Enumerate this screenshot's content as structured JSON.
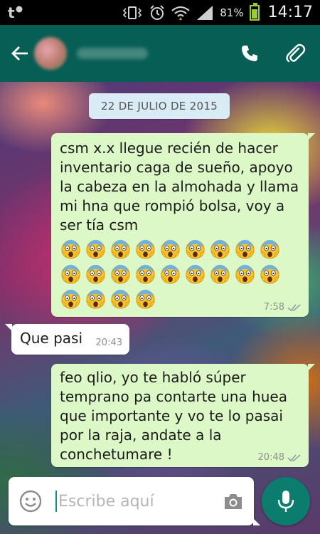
{
  "status_bar": {
    "battery_percent": "81%",
    "battery_level": 0.81,
    "time": "14:17",
    "icons": [
      "notification-t-icon",
      "vibrate-icon",
      "alarm-icon",
      "wifi-icon",
      "signal-icon",
      "battery-icon"
    ]
  },
  "app_bar": {
    "icons": [
      "back-arrow-icon",
      "phone-icon",
      "paperclip-icon"
    ],
    "color": "#075e54"
  },
  "chat": {
    "date_label": "22 DE JULIO DE 2015",
    "messages": [
      {
        "direction": "out",
        "text": "csm x.x llegue recién de hacer inventario caga de sueño, apoyo la cabeza en la almohada y llama mi hna que rompió bolsa, voy a ser tía csm",
        "emoji_name": "face-screaming-in-fear",
        "emoji_count": 22,
        "time": "7:58",
        "status": "double-check-read"
      },
      {
        "direction": "in",
        "text": "Que pasi",
        "time": "20:43"
      },
      {
        "direction": "out",
        "text": "feo qlio, yo te habló súper temprano pa contarte una huea que importante y vo te lo pasai por la raja, andate a la conchetumare !",
        "time": "20:48",
        "status": "double-check-read"
      }
    ]
  },
  "input": {
    "placeholder": "Escribe aquí",
    "icons": [
      "smiley-icon",
      "camera-icon",
      "microphone-icon"
    ]
  },
  "colors": {
    "outgoing_bubble": "#dcf8c6",
    "incoming_bubble": "#ffffff",
    "date_chip": "#d9ecf6",
    "mic_button": "#0c7c6f"
  }
}
